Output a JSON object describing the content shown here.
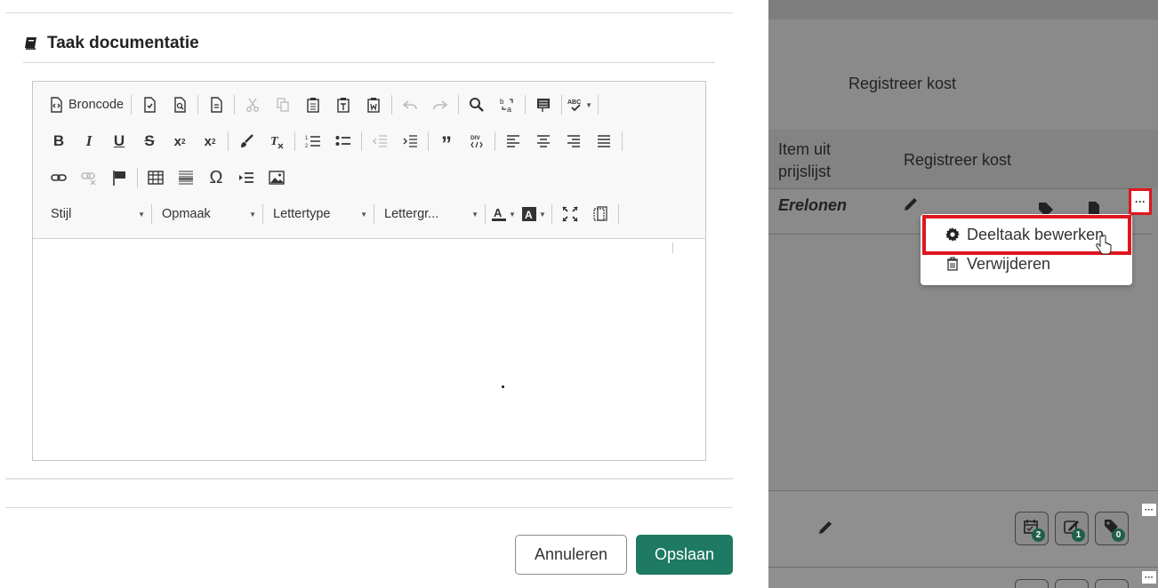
{
  "modal": {
    "section_title": "Taak documentatie",
    "toolbar": {
      "source_label": "Broncode",
      "combos": {
        "style": "Stijl",
        "format": "Opmaak",
        "font": "Lettertype",
        "size": "Lettergr..."
      }
    },
    "buttons": {
      "cancel": "Annuleren",
      "save": "Opslaan"
    }
  },
  "backdrop": {
    "register_cost_top": "Registreer kost",
    "table": {
      "col_item": "Item uit prijslijst",
      "col_register": "Registreer kost",
      "row_label": "Erelonen"
    },
    "more_button": "···",
    "badges": [
      {
        "icon": "calendar-check-icon",
        "count": "2"
      },
      {
        "icon": "edit-check-icon",
        "count": "1"
      },
      {
        "icon": "tag-icon",
        "count": "0"
      }
    ]
  },
  "context_menu": {
    "items": [
      {
        "label": "Deeltaak bewerken",
        "icon": "gear-icon"
      },
      {
        "label": "Verwijderen",
        "icon": "trash-icon"
      }
    ]
  },
  "colors": {
    "save_button": "#1e7a62",
    "highlight_border": "#e0161e",
    "backdrop": "#8a8a8a",
    "badge": "#1e5e4a"
  }
}
